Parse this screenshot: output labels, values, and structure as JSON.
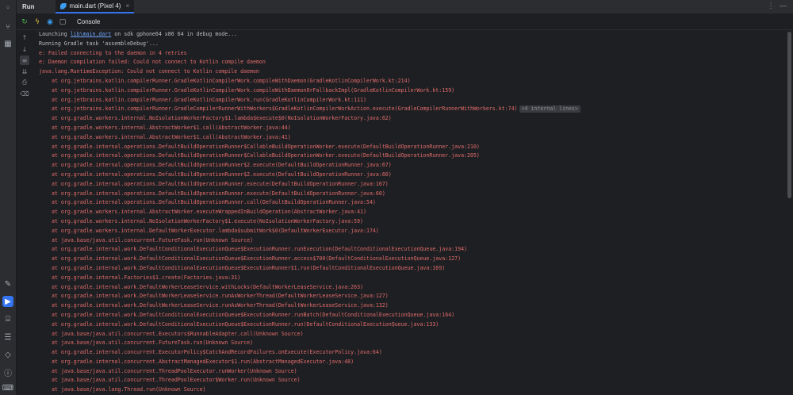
{
  "header": {
    "run_label": "Run",
    "tab_label": "main.dart (Pixel 4)",
    "close_glyph": "×",
    "more_glyph": "⋮  —"
  },
  "toolbar": {
    "console_label": "Console"
  },
  "colors": {
    "accent": "#3574f0",
    "error_text": "#e06c6c",
    "link": "#6ea8ff",
    "default_text": "#bcbec4",
    "background": "#1e1f22"
  },
  "console": {
    "launch_prefix": "Launching ",
    "launch_link": "lib\\main.dart",
    "launch_suffix": " on sdk gphone64 x86 64 in debug mode...",
    "gradle_task": "Running Gradle task 'assembleDebug'...",
    "errors": [
      "e: Failed connecting to the daemon in 4 retries",
      "e: Daemon compilation failed: Could not connect to Kotlin compile daemon",
      "java.lang.RuntimeException: Could not connect to Kotlin compile daemon"
    ],
    "stack_trace": [
      "at org.jetbrains.kotlin.compilerRunner.GradleKotlinCompilerWork.compileWithDaemon(GradleKotlinCompilerWork.kt:214)",
      "at org.jetbrains.kotlin.compilerRunner.GradleKotlinCompilerWork.compileWithDaemonOrFallbackImpl(GradleKotlinCompilerWork.kt:159)",
      "at org.jetbrains.kotlin.compilerRunner.GradleKotlinCompilerWork.run(GradleKotlinCompilerWork.kt:111)",
      "at org.jetbrains.kotlin.compilerRunner.GradleCompilerRunnerWithWorkers$GradleKotlinCompilerWorkAction.execute(GradleCompilerRunnerWithWorkers.kt:74)",
      "at org.gradle.workers.internal.NoIsolationWorkerFactory$1.lambda$execute$0(NoIsolationWorkerFactory.java:62)",
      "at org.gradle.workers.internal.AbstractWorker$1.call(AbstractWorker.java:44)",
      "at org.gradle.workers.internal.AbstractWorker$1.call(AbstractWorker.java:41)",
      "at org.gradle.internal.operations.DefaultBuildOperationRunner$CallableBuildOperationWorker.execute(DefaultBuildOperationRunner.java:210)",
      "at org.gradle.internal.operations.DefaultBuildOperationRunner$CallableBuildOperationWorker.execute(DefaultBuildOperationRunner.java:205)",
      "at org.gradle.internal.operations.DefaultBuildOperationRunner$2.execute(DefaultBuildOperationRunner.java:67)",
      "at org.gradle.internal.operations.DefaultBuildOperationRunner$2.execute(DefaultBuildOperationRunner.java:60)",
      "at org.gradle.internal.operations.DefaultBuildOperationRunner.execute(DefaultBuildOperationRunner.java:167)",
      "at org.gradle.internal.operations.DefaultBuildOperationRunner.execute(DefaultBuildOperationRunner.java:60)",
      "at org.gradle.internal.operations.DefaultBuildOperationRunner.call(DefaultBuildOperationRunner.java:54)",
      "at org.gradle.workers.internal.AbstractWorker.executeWrappedInBuildOperation(AbstractWorker.java:41)",
      "at org.gradle.workers.internal.NoIsolationWorkerFactory$1.execute(NoIsolationWorkerFactory.java:59)",
      "at org.gradle.workers.internal.DefaultWorkerExecutor.lambda$submitWork$0(DefaultWorkerExecutor.java:174)",
      "at java.base/java.util.concurrent.FutureTask.run(Unknown Source)",
      "at org.gradle.internal.work.DefaultConditionalExecutionQueue$ExecutionRunner.runExecution(DefaultConditionalExecutionQueue.java:194)",
      "at org.gradle.internal.work.DefaultConditionalExecutionQueue$ExecutionRunner.access$700(DefaultConditionalExecutionQueue.java:127)",
      "at org.gradle.internal.work.DefaultConditionalExecutionQueue$ExecutionRunner$1.run(DefaultConditionalExecutionQueue.java:169)",
      "at org.gradle.internal.Factories$1.create(Factories.java:31)",
      "at org.gradle.internal.work.DefaultWorkerLeaseService.withLocks(DefaultWorkerLeaseService.java:263)",
      "at org.gradle.internal.work.DefaultWorkerLeaseService.runAsWorkerThread(DefaultWorkerLeaseService.java:127)",
      "at org.gradle.internal.work.DefaultWorkerLeaseService.runAsWorkerThread(DefaultWorkerLeaseService.java:132)",
      "at org.gradle.internal.work.DefaultConditionalExecutionQueue$ExecutionRunner.runBatch(DefaultConditionalExecutionQueue.java:164)",
      "at org.gradle.internal.work.DefaultConditionalExecutionQueue$ExecutionRunner.run(DefaultConditionalExecutionQueue.java:133)",
      "at java.base/java.util.concurrent.Executors$RunnableAdapter.call(Unknown Source)",
      "at java.base/java.util.concurrent.FutureTask.run(Unknown Source)",
      "at org.gradle.internal.concurrent.ExecutorPolicy$CatchAndRecordFailures.onExecute(ExecutorPolicy.java:64)",
      "at org.gradle.internal.concurrent.AbstractManagedExecutor$1.run(AbstractManagedExecutor.java:48)",
      "at java.base/java.util.concurrent.ThreadPoolExecutor.runWorker(Unknown Source)",
      "at java.base/java.util.concurrent.ThreadPoolExecutor$Worker.run(Unknown Source)",
      "at java.base/java.lang.Thread.run(Unknown Source)"
    ],
    "folded_index": 3,
    "folded_label": "<4 internal lines>",
    "fold_glyph": "›"
  }
}
